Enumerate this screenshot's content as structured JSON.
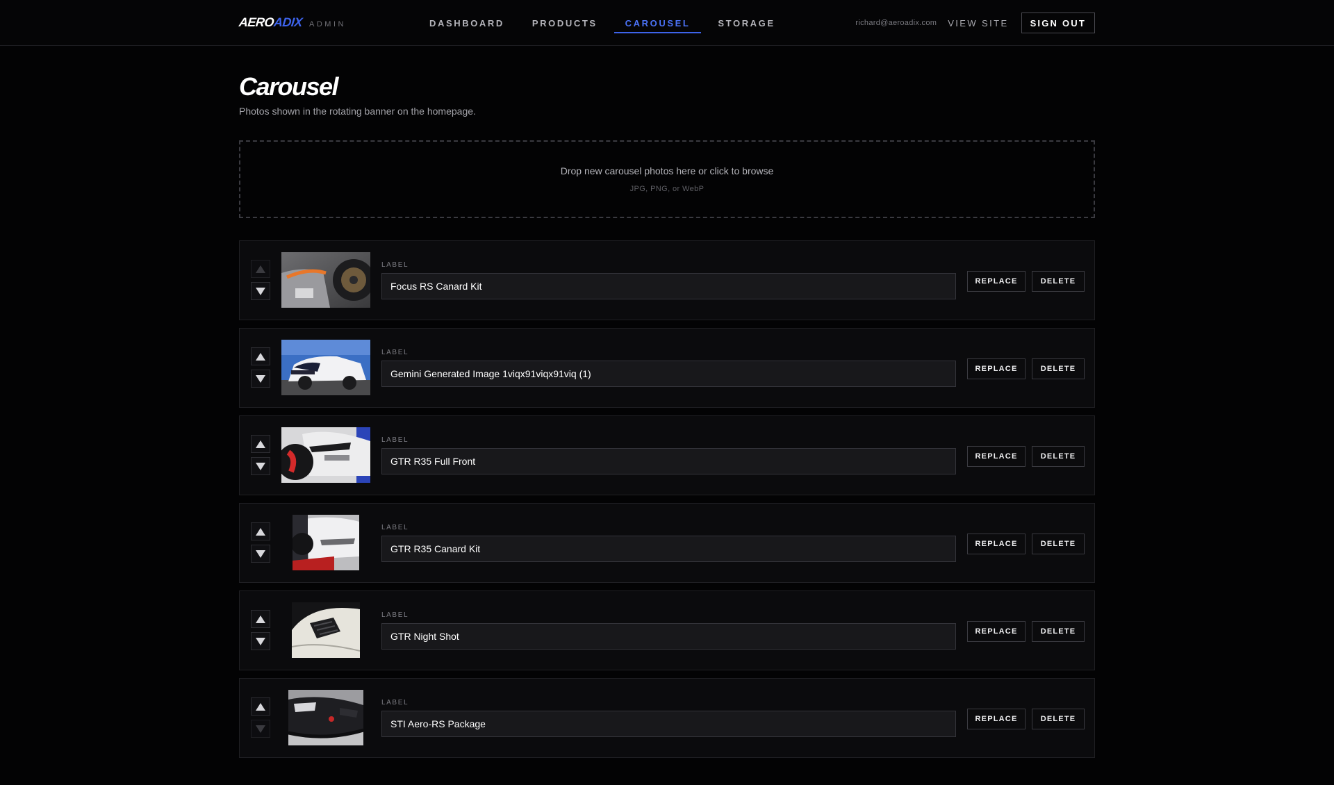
{
  "header": {
    "logo_part1": "AERO",
    "logo_part2": "ADIX",
    "admin_tag": "ADMIN",
    "nav": [
      {
        "label": "DASHBOARD",
        "active": false
      },
      {
        "label": "PRODUCTS",
        "active": false
      },
      {
        "label": "CAROUSEL",
        "active": true
      },
      {
        "label": "STORAGE",
        "active": false
      }
    ],
    "user_email": "richard@aeroadix.com",
    "view_site": "VIEW SITE",
    "sign_out": "SIGN OUT"
  },
  "page": {
    "title": "Carousel",
    "subtitle": "Photos shown in the rotating banner on the homepage."
  },
  "dropzone": {
    "main_text": "Drop new carousel photos here or click to browse",
    "sub_text": "JPG, PNG, or WebP"
  },
  "items": [
    {
      "field_label": "LABEL",
      "label": "Focus RS Canard Kit",
      "replace": "REPLACE",
      "delete": "DELETE",
      "up_disabled": true,
      "down_disabled": false
    },
    {
      "field_label": "LABEL",
      "label": "Gemini Generated Image 1viqx91viqx91viq (1)",
      "replace": "REPLACE",
      "delete": "DELETE",
      "up_disabled": false,
      "down_disabled": false
    },
    {
      "field_label": "LABEL",
      "label": "GTR R35 Full Front",
      "replace": "REPLACE",
      "delete": "DELETE",
      "up_disabled": false,
      "down_disabled": false
    },
    {
      "field_label": "LABEL",
      "label": "GTR R35 Canard Kit",
      "replace": "REPLACE",
      "delete": "DELETE",
      "up_disabled": false,
      "down_disabled": false
    },
    {
      "field_label": "LABEL",
      "label": "GTR Night Shot",
      "replace": "REPLACE",
      "delete": "DELETE",
      "up_disabled": false,
      "down_disabled": false
    },
    {
      "field_label": "LABEL",
      "label": "STI Aero-RS Package",
      "replace": "REPLACE",
      "delete": "DELETE",
      "up_disabled": false,
      "down_disabled": true
    }
  ],
  "colors": {
    "accent": "#3d63ea",
    "background": "#030304",
    "row_background": "#0b0b0d"
  }
}
